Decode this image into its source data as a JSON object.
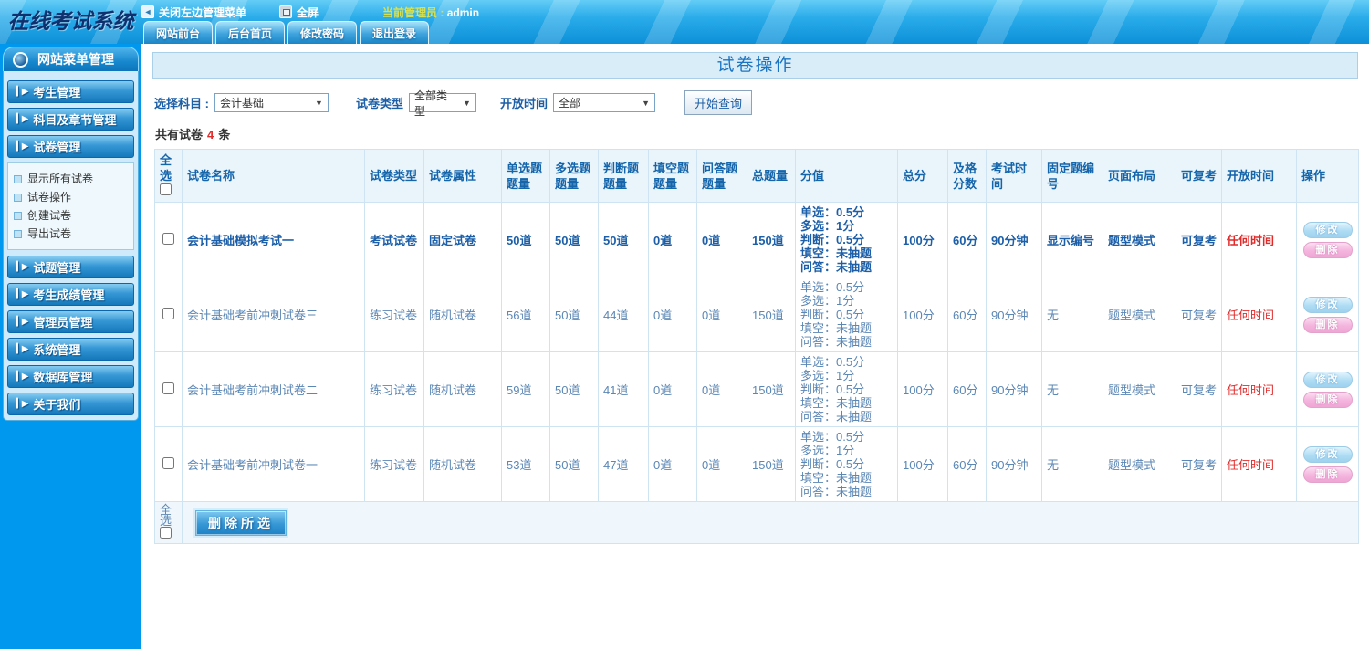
{
  "header": {
    "logo": "在线考试系统",
    "close_menu": "关闭左边管理菜单",
    "collapse_glyph": "◄",
    "fullscreen": "全屏",
    "admin_label": "当前管理员 :",
    "admin_name": "admin",
    "tabs": [
      {
        "label": "网站前台"
      },
      {
        "label": "后台首页"
      },
      {
        "label": "修改密码"
      },
      {
        "label": "退出登录"
      }
    ]
  },
  "sidebar": {
    "title": "网站菜单管理",
    "items": [
      {
        "label": "考生管理"
      },
      {
        "label": "科目及章节管理"
      },
      {
        "label": "试卷管理"
      },
      {
        "label": "试题管理"
      },
      {
        "label": "考生成绩管理"
      },
      {
        "label": "管理员管理"
      },
      {
        "label": "系统管理"
      },
      {
        "label": "数据库管理"
      },
      {
        "label": "关于我们"
      }
    ],
    "submenu": [
      {
        "label": "显示所有试卷"
      },
      {
        "label": "试卷操作"
      },
      {
        "label": "创建试卷"
      },
      {
        "label": "导出试卷"
      }
    ]
  },
  "main": {
    "page_title": "试卷操作",
    "filters": {
      "subject_label": "选择科目 :",
      "subject_value": "会计基础",
      "type_label": "试卷类型",
      "type_value": "全部类型",
      "open_label": "开放时间",
      "open_value": "全部",
      "search_button": "开始查询",
      "arrow": "▼"
    },
    "count": {
      "prefix": "共有试卷",
      "value": "4",
      "suffix": "条"
    },
    "table": {
      "headers": [
        "全选",
        "试卷名称",
        "试卷类型",
        "试卷属性",
        "单选题题量",
        "多选题题量",
        "判断题题量",
        "填空题题量",
        "问答题题量",
        "总题量",
        "分值",
        "总分",
        "及格分数",
        "考试时间",
        "固定题编号",
        "页面布局",
        "可复考",
        "开放时间",
        "操作"
      ],
      "actions": {
        "edit": "修改",
        "delete": "删除"
      },
      "rows": [
        {
          "name": "会计基础模拟考试一",
          "type": "考试试卷",
          "attr": "固定试卷",
          "single": "50道",
          "multi": "50道",
          "judge": "50道",
          "blank": "0道",
          "qa": "0道",
          "total": "150道",
          "scores": [
            "单选：0.5分",
            "多选：1分",
            "判断：0.5分",
            "填空：未抽题",
            "问答：未抽题"
          ],
          "total_score": "100分",
          "pass_score": "60分",
          "duration": "90分钟",
          "fixed_no": "显示编号",
          "layout": "题型模式",
          "retake": "可复考",
          "open_time": "任何时间"
        },
        {
          "name": "会计基础考前冲刺试卷三",
          "type": "练习试卷",
          "attr": "随机试卷",
          "single": "56道",
          "multi": "50道",
          "judge": "44道",
          "blank": "0道",
          "qa": "0道",
          "total": "150道",
          "scores": [
            "单选：0.5分",
            "多选：1分",
            "判断：0.5分",
            "填空：未抽题",
            "问答：未抽题"
          ],
          "total_score": "100分",
          "pass_score": "60分",
          "duration": "90分钟",
          "fixed_no": "无",
          "layout": "题型模式",
          "retake": "可复考",
          "open_time": "任何时间"
        },
        {
          "name": "会计基础考前冲刺试卷二",
          "type": "练习试卷",
          "attr": "随机试卷",
          "single": "59道",
          "multi": "50道",
          "judge": "41道",
          "blank": "0道",
          "qa": "0道",
          "total": "150道",
          "scores": [
            "单选：0.5分",
            "多选：1分",
            "判断：0.5分",
            "填空：未抽题",
            "问答：未抽题"
          ],
          "total_score": "100分",
          "pass_score": "60分",
          "duration": "90分钟",
          "fixed_no": "无",
          "layout": "题型模式",
          "retake": "可复考",
          "open_time": "任何时间"
        },
        {
          "name": "会计基础考前冲刺试卷一",
          "type": "练习试卷",
          "attr": "随机试卷",
          "single": "53道",
          "multi": "50道",
          "judge": "47道",
          "blank": "0道",
          "qa": "0道",
          "total": "150道",
          "scores": [
            "单选：0.5分",
            "多选：1分",
            "判断：0.5分",
            "填空：未抽题",
            "问答：未抽题"
          ],
          "total_score": "100分",
          "pass_score": "60分",
          "duration": "90分钟",
          "fixed_no": "无",
          "layout": "题型模式",
          "retake": "可复考",
          "open_time": "任何时间"
        }
      ],
      "footer": {
        "select_all": "全选",
        "delete_selected": "删除所选"
      }
    }
  },
  "colors": {
    "accent_blue": "#0d90d8",
    "sidebar_blue": "#0097ef",
    "header_text": "#1565ab",
    "alert_red": "#e02b2b",
    "admin_yellow": "#d9e04e"
  }
}
